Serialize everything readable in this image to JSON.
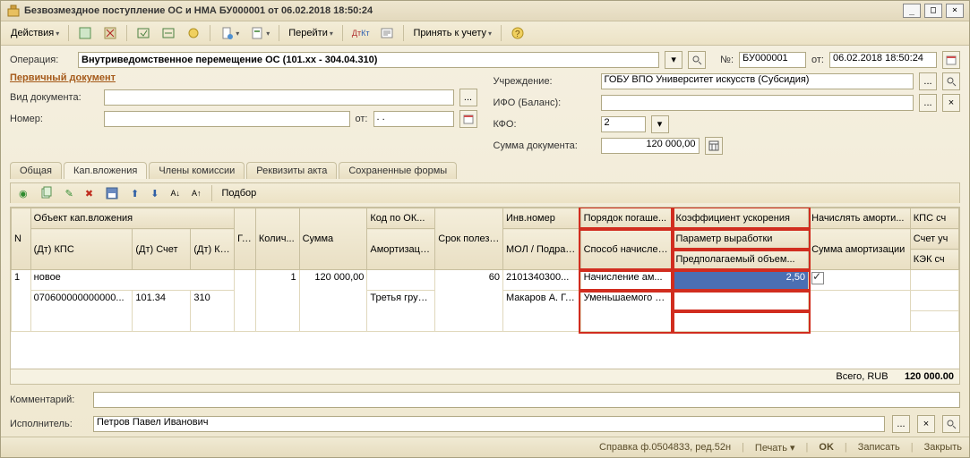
{
  "window": {
    "title": "Безвозмездное поступление ОС и НМА БУ000001 от 06.02.2018 18:50:24"
  },
  "toolbar": {
    "actions": "Действия",
    "goto": "Перейти",
    "accept": "Принять к учету"
  },
  "operation": {
    "label": "Операция:",
    "value": "Внутриведомственное перемещение ОС (101.xx - 304.04.310)",
    "num_label": "№:",
    "num_value": "БУ000001",
    "date_label": "от:",
    "date_value": "06.02.2018 18:50:24"
  },
  "primary_doc_section": "Первичный документ",
  "left": {
    "doc_type_label": "Вид документа:",
    "doc_type_value": "",
    "number_label": "Номер:",
    "number_value": "",
    "number_from_label": "от:",
    "number_from_value": ". ."
  },
  "right": {
    "org_label": "Учреждение:",
    "org_value": "ГОБУ ВПО Университет искусств (Субсидия)",
    "ifo_label": "ИФО (Баланс):",
    "ifo_value": "",
    "kfo_label": "КФО:",
    "kfo_value": "2",
    "sum_label": "Сумма документа:",
    "sum_value": "120 000,00"
  },
  "tabs": [
    "Общая",
    "Кап.вложения",
    "Члены комиссии",
    "Реквизиты акта",
    "Сохраненные формы"
  ],
  "grid_toolbar": {
    "podbor": "Подбор"
  },
  "grid": {
    "headers_row1": [
      "N",
      "Объект кап.вложения",
      "Г. у..",
      "Колич...",
      "Сумма",
      "Код по ОК...",
      "Срок полезн. исполь...",
      "Инв.номер",
      "Порядок погаше...",
      "Коэффициент ускорения",
      "Начислять аморти...",
      "КПС сч"
    ],
    "headers_row2": [
      "",
      "(Дт) КПС",
      "(Дт) Счет",
      "(Дт) КЭК",
      "",
      "",
      "",
      "Амортизац. группа",
      "",
      "МОЛ / Подразделе...",
      "Способ начисления ...",
      "Параметр выработки",
      "Сумма амортизации",
      "Счет уч"
    ],
    "headers_row3": [
      "Предполагаемый объем...",
      "КЭК сч"
    ],
    "rows": [
      {
        "n": "1",
        "obj": "новое",
        "kps": "070600000000000...",
        "schet": "101.34",
        "kek": "310",
        "gu": "",
        "qty": "1",
        "sum": "120 000,00",
        "okof": "",
        "amort_group": "Третья группа ...",
        "srok": "60",
        "inv": "2101340300...",
        "mol": "Макаров А. Г. - Склад",
        "poryadok": "Начисление ам...",
        "sposob": "Уменьшаемого остатка",
        "koef": "2,50",
        "nachisl": true
      }
    ]
  },
  "totals": {
    "label": "Всего, RUB",
    "value": "120 000.00"
  },
  "comment_label": "Комментарий:",
  "comment_value": "",
  "executor_label": "Исполнитель:",
  "executor_value": "Петров Павел Иванович",
  "status": {
    "help": "Справка ф.0504833, ред.52н",
    "print": "Печать",
    "ok": "OK",
    "save": "Записать",
    "close": "Закрыть"
  }
}
